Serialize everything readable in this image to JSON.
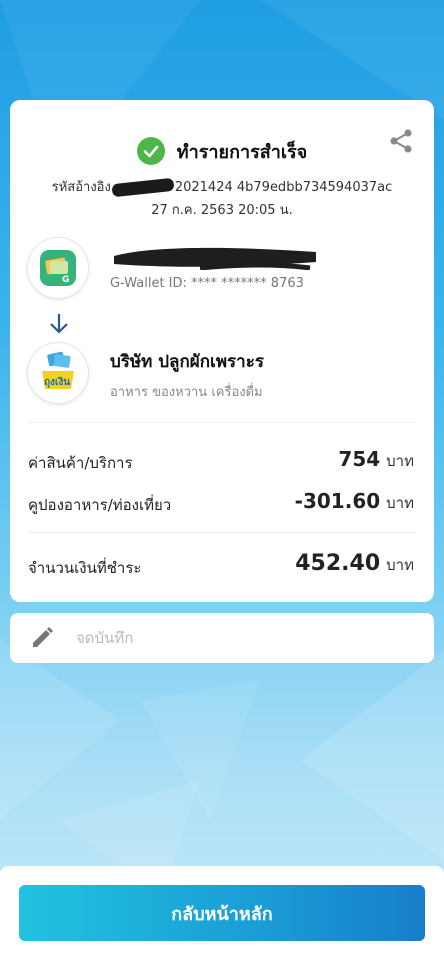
{
  "status": {
    "title": "ทำรายการสำเร็จ"
  },
  "reference": {
    "prefix": "รหัสอ้างอิง",
    "suffix": "2021424 4b79edbb734594037ac"
  },
  "datetime": "27 ก.ค. 2563 20:05 น.",
  "payer": {
    "wallet_id": "G-Wallet ID: **** ******* 8763"
  },
  "merchant": {
    "name": "บริษัท ปลูกผักเพราะร",
    "category": "อาหาร ของหวาน เครื่องดื่ม",
    "logo_text": "ถุงเงิน"
  },
  "summary": {
    "goods_label": "ค่าสินค้า/บริการ",
    "goods_amount": "754",
    "coupon_label": "คูปองอาหาร/ท่องเที่ยว",
    "coupon_amount": "-301.60",
    "total_label": "จำนวนเงินที่ชำระ",
    "total_amount": "452.40",
    "currency": "บาท"
  },
  "note": {
    "placeholder": "จดบันทึก",
    "value": ""
  },
  "actions": {
    "home_label": "กลับหน้าหลัก"
  },
  "colors": {
    "success": "#4cb648",
    "button_start": "#21c3df",
    "button_end": "#177ecb"
  }
}
